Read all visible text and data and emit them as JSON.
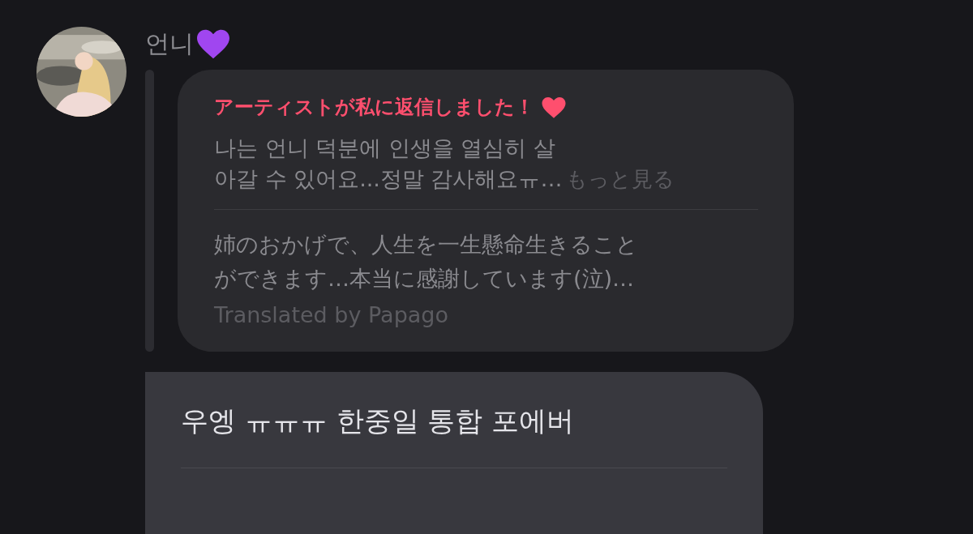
{
  "message": {
    "sender": "언니",
    "reply_card": {
      "title": "アーティストが私に返信しました！",
      "original_lines": [
        "나는 언니 덕분에 인생을 열심히 살",
        "아갈 수 있어요...정말 감사해요ㅠ…"
      ],
      "more_link": "もっと見る",
      "translation_lines": [
        "姉のおかげで、人生を一生懸命生きること",
        "ができます…本当に感謝しています(泣)…"
      ],
      "translation_credit": "Translated by Papago"
    },
    "reply_text": "우엥 ㅠㅠㅠ 한중일 통합 포에버"
  }
}
